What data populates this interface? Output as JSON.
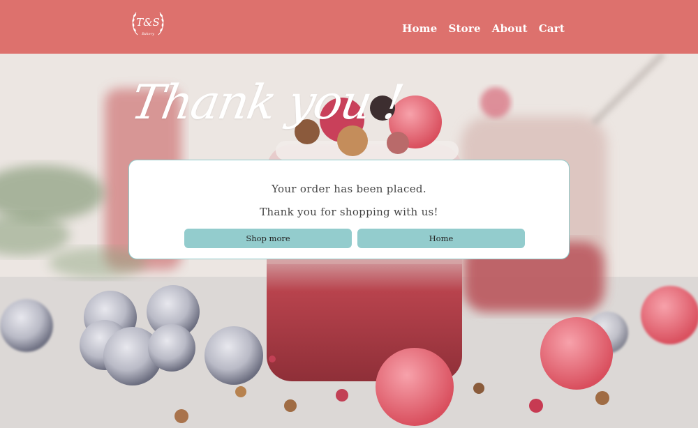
{
  "header": {
    "logo_text": "T&S Bakery",
    "nav": [
      "Home",
      "Store",
      "About",
      "Cart"
    ]
  },
  "hero": {
    "heading": "Thank you !"
  },
  "confirmation": {
    "line1": "Your order has been placed.",
    "line2": "Thank you for shopping with us!",
    "shop_more_label": "Shop more",
    "home_label": "Home"
  },
  "colors": {
    "header_bg": "#dd716d",
    "button_bg": "#93cccd",
    "card_border": "#8fcbcb"
  }
}
